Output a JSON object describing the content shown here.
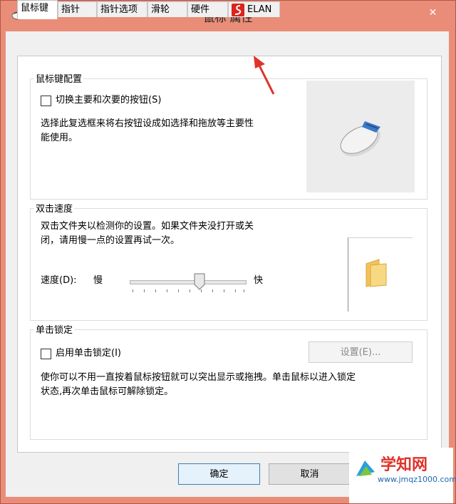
{
  "window": {
    "title": "鼠标 属性",
    "close_label": "✕"
  },
  "tabs": [
    {
      "label": "鼠标键"
    },
    {
      "label": "指针"
    },
    {
      "label": "指针选项"
    },
    {
      "label": "滑轮"
    },
    {
      "label": "硬件"
    },
    {
      "label": "ELAN"
    }
  ],
  "button_config": {
    "group_label": "鼠标键配置",
    "swap_label": "切换主要和次要的按钮(S)",
    "swap_checked": false,
    "description_line1": "选择此复选框来将右按钮设成如选择和拖放等主要性",
    "description_line2": "能使用。"
  },
  "double_click": {
    "group_label": "双击速度",
    "description_line1": "双击文件夹以检测你的设置。如果文件夹没打开或关",
    "description_line2": "闭，请用慢一点的设置再试一次。",
    "speed_label": "速度(D):",
    "slow_label": "慢",
    "fast_label": "快",
    "speed_level_fraction": 0.55
  },
  "click_lock": {
    "group_label": "单击锁定",
    "enable_label": "启用单击锁定(I)",
    "enable_checked": false,
    "settings_button": "设置(E)...",
    "description_line1": "使你可以不用一直按着鼠标按钮就可以突出显示或拖拽。单击鼠标以进入锁定",
    "description_line2": "状态,再次单击鼠标可解除锁定。"
  },
  "footer": {
    "ok_label": "确定",
    "cancel_label": "取消"
  },
  "watermark": {
    "brand": "学知网",
    "url": "www.jmqz1000.com"
  },
  "colors": {
    "title_bar": "#e98d78",
    "arrow": "#e0332a",
    "elan_icon": "#d9251c"
  }
}
